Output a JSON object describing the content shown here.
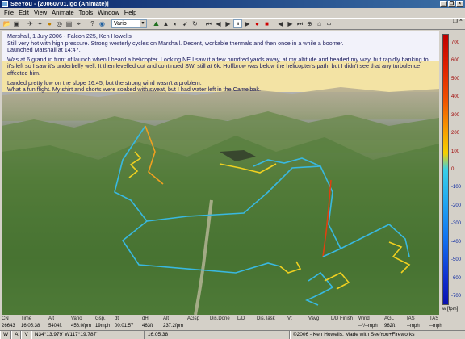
{
  "window": {
    "title": "SeeYou - [20060701.igc (Animate)]",
    "minimize": "_",
    "restore": "❐",
    "close": "×"
  },
  "menu": [
    "File",
    "Edit",
    "View",
    "Animate",
    "Tools",
    "Window",
    "Help"
  ],
  "mdi_controls": [
    "_",
    "❐",
    "×"
  ],
  "toolbar": {
    "combo_value": "Vario"
  },
  "notes": {
    "line1": "Marshall, 1 July 2006 - Falcon 225, Ken Howells",
    "line2": "Still very hot with high pressure. Strong westerly cycles on Marshall. Decent, workable thermals and then once in a while a boomer.",
    "line3": "Launched Marshall at 14:47.",
    "para2": "Was at 6 grand in front of launch when I heard a helicopter. Looking NE I saw it a few hundred yards away, at my altitude and headed my way, but rapidly banking to it's left so I saw it's underbelly well. It then levelled out and continued SW, still at 6k. Hoffbrow was below the helicopter's path, but I didn't see that any turbulence affected him.",
    "para3a": "Landed pretty low on the slope 16:45, but the strong wind wasn't a problem.",
    "para3b": "What a fun flight. My shirt and shorts were soaked with sweat, but I had water left in the Camelbak."
  },
  "scale": {
    "ticks": [
      "700",
      "600",
      "500",
      "400",
      "300",
      "200",
      "100",
      "0",
      "-100",
      "-200",
      "-300",
      "-400",
      "-500",
      "-600",
      "-700"
    ],
    "unit": "w [fpm]"
  },
  "status_headers": [
    "CN",
    "Time",
    "Alt",
    "Vario",
    "Gsp.",
    "dt",
    "dH",
    "Alt",
    "AGsp",
    "Dis.Done",
    "L/D",
    "Dis.Task",
    "Vt",
    "Vavg",
    "L/D Finish",
    "Wind",
    "AGL",
    "IAS",
    "TAS"
  ],
  "status_values": [
    "26643",
    "16:05:38",
    "5404ft",
    "456.0fpm",
    "19mph",
    "00:01:57",
    "463ft",
    "237.2fpm",
    "",
    "",
    "",
    "",
    "",
    "",
    "",
    "--*/--mph",
    "962ft",
    "--mph",
    "--mph"
  ],
  "statusbar": {
    "mode1": "W",
    "mode2": "A",
    "mode3": "V",
    "coords": "N34°13.979' W117°19.787'",
    "time": "16:05:38",
    "copyright": "©2006 - Ken Howells. Made with SeeYou+Fireworks"
  },
  "colors": {
    "title_start": "#0a246a",
    "title_end": "#3a6ea5",
    "note_bg": "#f3e3a4",
    "track_cyan": "#39b8e0",
    "track_yellow": "#f0d020",
    "track_red": "#e04010"
  }
}
